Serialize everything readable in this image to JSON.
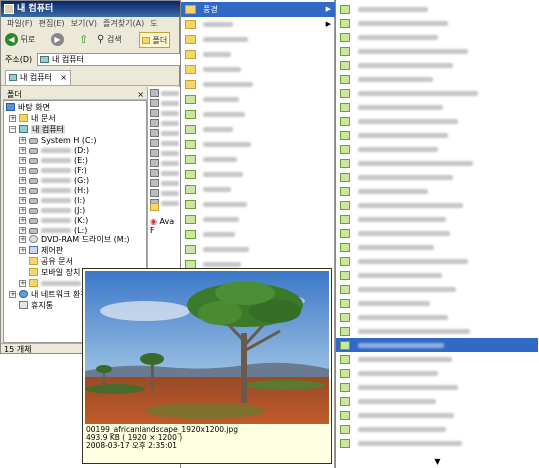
{
  "window": {
    "title": "내 컴퓨터",
    "status": "15 개체"
  },
  "menubar": [
    "파일(F)",
    "편집(E)",
    "보기(V)",
    "즐겨찾기(A)",
    "도"
  ],
  "toolbar": {
    "back": "뒤로",
    "search": "검색",
    "folders": "폴더"
  },
  "address": {
    "label": "주소(D)",
    "value": "내 컴퓨터"
  },
  "tab": {
    "label": "내 컴퓨터",
    "close": "×"
  },
  "pane": {
    "header": "폴더",
    "close": "×"
  },
  "tree": {
    "desktop": "바탕 화면",
    "mydocs": "내 문서",
    "mycomputer": "내 컴퓨터",
    "drives": [
      {
        "name": "System H (C:)",
        "hidden": false
      },
      {
        "name": "(D:)",
        "hidden": true
      },
      {
        "name": "(E:)",
        "hidden": true
      },
      {
        "name": "(F:)",
        "hidden": true
      },
      {
        "name": "(G:)",
        "hidden": true
      },
      {
        "name": "(H:)",
        "hidden": true
      },
      {
        "name": "(I:)",
        "hidden": true
      },
      {
        "name": "(J:)",
        "hidden": true
      },
      {
        "name": "(K:)",
        "hidden": true
      },
      {
        "name": "(L:)",
        "hidden": true
      }
    ],
    "dvd": "DVD-RAM 드라이브 (M:)",
    "control": "제어판",
    "shared": "공유 문서",
    "mobile": "모바일 장치",
    "network": "내 네트워크 환경",
    "recycle": "휴지통"
  },
  "right_list": {
    "file": "Ava F"
  },
  "menu1": {
    "selected": "풍경",
    "submenu_arrow": "▶"
  },
  "menu2": {
    "down_arrow": "▼"
  },
  "tooltip": {
    "filename": "00199_africanlandscape_1920x1200.jpg",
    "size": "493.9 KB    ( 1920 × 1200 )",
    "date": "2008-03-17 오후 2:35:01"
  }
}
